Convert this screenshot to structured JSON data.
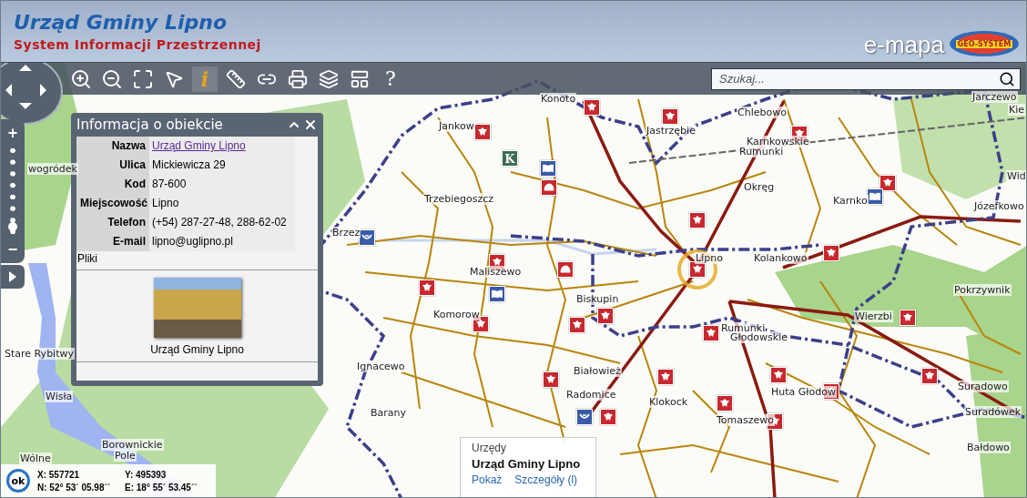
{
  "header": {
    "title": "Urząd Gminy Lipno",
    "subtitle": "System Informacji Przestrzennej",
    "brand": "e-mapa",
    "logo_text": "GEO-SYSTEM"
  },
  "toolbar": {
    "tools": [
      {
        "kind": "zoom-in"
      },
      {
        "kind": "zoom-out"
      },
      {
        "kind": "full-extent"
      },
      {
        "kind": "select"
      },
      {
        "kind": "info",
        "selected": true,
        "text": "i"
      },
      {
        "kind": "measure"
      },
      {
        "kind": "link"
      },
      {
        "kind": "print"
      },
      {
        "kind": "layers"
      },
      {
        "kind": "layout"
      },
      {
        "kind": "help",
        "text": "?"
      }
    ],
    "search": {
      "placeholder": "Szukaj..."
    }
  },
  "zoom": {
    "level": 0.12,
    "plus": "+",
    "minus": "−"
  },
  "map": {
    "labels": [
      {
        "text": "Konoto"
      },
      {
        "text": "Jarczewo"
      },
      {
        "text": "Kie"
      },
      {
        "text": "Jankow"
      },
      {
        "text": "Chlebowo"
      },
      {
        "text": "Jastrzębie"
      },
      {
        "text": "Karnkowskie"
      },
      {
        "text": "Rumunki"
      },
      {
        "text": "Okręg"
      },
      {
        "text": "wogródek"
      },
      {
        "text": "Wid"
      },
      {
        "text": "Trzebiegoszcz"
      },
      {
        "text": "Karnko"
      },
      {
        "text": "Józefkowo"
      },
      {
        "text": "Brzez"
      },
      {
        "text": "Lipno"
      },
      {
        "text": "Kolankowo"
      },
      {
        "text": "Maliszewo"
      },
      {
        "text": "Biskupin"
      },
      {
        "text": "Pokrzywnik"
      },
      {
        "text": "Komorow"
      },
      {
        "text": "Wierzbi"
      },
      {
        "text": "Rumunki"
      },
      {
        "text": "Głodowskie"
      },
      {
        "text": "Stare Rybitwy"
      },
      {
        "text": "Ignacewo"
      },
      {
        "text": "Białowież"
      },
      {
        "text": "Huta Głodow"
      },
      {
        "text": "Suradowo"
      },
      {
        "text": "Radomice"
      },
      {
        "text": "Klokock"
      },
      {
        "text": "Wisła"
      },
      {
        "text": "Barany"
      },
      {
        "text": "Tomaszewo"
      },
      {
        "text": "Suradówek"
      },
      {
        "text": "Bałdowo"
      },
      {
        "text": "Wólne"
      },
      {
        "text": "Borownickie"
      },
      {
        "text": "Pole"
      }
    ],
    "markers": [
      {
        "kind": "emblem"
      },
      {
        "kind": "emblem"
      },
      {
        "kind": "emblem"
      },
      {
        "kind": "emblem"
      },
      {
        "kind": "emblem"
      },
      {
        "kind": "emblem"
      },
      {
        "kind": "emblem",
        "selected": true
      },
      {
        "kind": "emblem"
      },
      {
        "kind": "emblem"
      },
      {
        "kind": "emblem"
      },
      {
        "kind": "emblem"
      },
      {
        "kind": "emblem"
      },
      {
        "kind": "emblem"
      },
      {
        "kind": "emblem"
      },
      {
        "kind": "emblem"
      },
      {
        "kind": "emblem"
      },
      {
        "kind": "emblem"
      },
      {
        "kind": "emblem"
      },
      {
        "kind": "emblem"
      },
      {
        "kind": "emblem"
      },
      {
        "kind": "emblem"
      },
      {
        "kind": "emblem"
      },
      {
        "kind": "emblem"
      },
      {
        "kind": "library"
      },
      {
        "kind": "library"
      },
      {
        "kind": "library"
      },
      {
        "kind": "post"
      },
      {
        "kind": "post"
      },
      {
        "kind": "letter",
        "text": "K"
      },
      {
        "kind": "fire"
      },
      {
        "kind": "fire"
      }
    ]
  },
  "info_panel": {
    "title": "Informacja o obiekcie",
    "rows": [
      {
        "label": "Nazwa",
        "value": "Urząd Gminy Lipno",
        "kind": "link"
      },
      {
        "label": "Ulica",
        "value": "Mickiewicza 29",
        "kind": "text"
      },
      {
        "label": "Kod",
        "value": "87-600",
        "kind": "text"
      },
      {
        "label": "Miejscowość",
        "value": "Lipno",
        "kind": "text"
      },
      {
        "label": "Telefon",
        "value": "(+54) 287-27-48, 288-62-02",
        "kind": "text"
      },
      {
        "label": "E-mail",
        "value": "lipno@uglipno.pl",
        "kind": "text"
      }
    ],
    "files_label": "Pliki",
    "photo_caption": "Urząd Gminy Lipno"
  },
  "popup": {
    "category": "Urzędy",
    "name": "Urząd Gminy Lipno",
    "links": [
      "Pokaż",
      "Szczegóły (l)"
    ]
  },
  "coordinates": {
    "button": "ok",
    "x": "X: 557721",
    "y": "Y: 495393",
    "n": "N: 52° 53´ 05.98´´",
    "e": "E: 18° 55´ 53.45´´"
  }
}
